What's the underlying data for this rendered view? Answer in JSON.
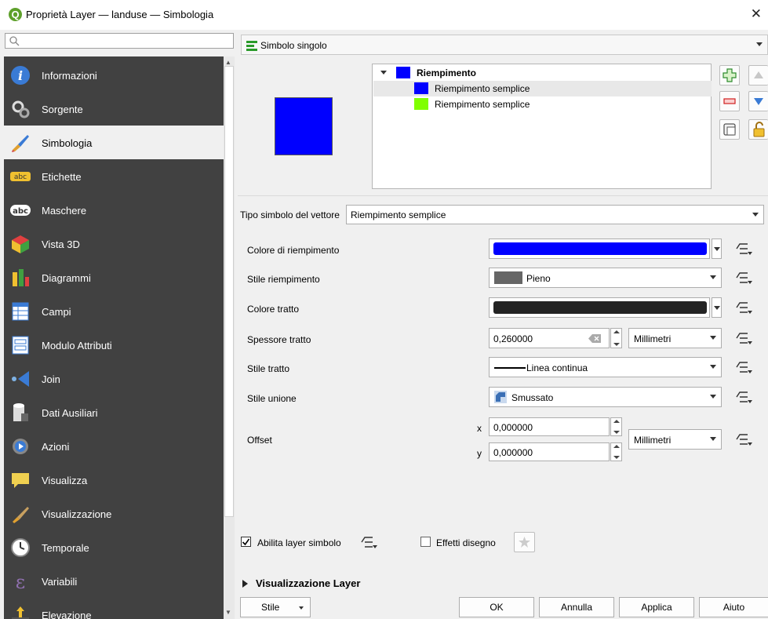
{
  "window": {
    "title": "Proprietà Layer — landuse — Simbologia",
    "app_icon": "Q"
  },
  "search": {
    "placeholder": ""
  },
  "sidebar": {
    "items": [
      {
        "label": "Informazioni",
        "icon": "info-icon"
      },
      {
        "label": "Sorgente",
        "icon": "source-icon"
      },
      {
        "label": "Simbologia",
        "icon": "symbology-icon",
        "active": true
      },
      {
        "label": "Etichette",
        "icon": "labels-icon"
      },
      {
        "label": "Maschere",
        "icon": "masks-icon"
      },
      {
        "label": "Vista 3D",
        "icon": "3d-view-icon"
      },
      {
        "label": "Diagrammi",
        "icon": "diagrams-icon"
      },
      {
        "label": "Campi",
        "icon": "fields-icon"
      },
      {
        "label": "Modulo Attributi",
        "icon": "attributes-form-icon"
      },
      {
        "label": "Join",
        "icon": "join-icon"
      },
      {
        "label": "Dati Ausiliari",
        "icon": "auxiliary-data-icon"
      },
      {
        "label": "Azioni",
        "icon": "actions-icon"
      },
      {
        "label": "Visualizza",
        "icon": "display-icon"
      },
      {
        "label": "Visualizzazione",
        "icon": "rendering-icon"
      },
      {
        "label": "Temporale",
        "icon": "temporal-icon"
      },
      {
        "label": "Variabili",
        "icon": "variables-icon"
      },
      {
        "label": "Elevazione",
        "icon": "elevation-icon"
      }
    ]
  },
  "renderer": {
    "label": "Simbolo singolo"
  },
  "symbol_tree": {
    "root": {
      "label": "Riempimento",
      "color": "#0000ff"
    },
    "layers": [
      {
        "label": "Riempimento semplice",
        "color": "#0000ff",
        "selected": true
      },
      {
        "label": "Riempimento semplice",
        "color": "#80ff00",
        "selected": false
      }
    ]
  },
  "symbol_layer_type": {
    "label": "Tipo simbolo del vettore",
    "value": "Riempimento semplice"
  },
  "properties": {
    "fill_color": {
      "label": "Colore di riempimento",
      "color": "#0000ff"
    },
    "fill_style": {
      "label": "Stile riempimento",
      "value": "Pieno"
    },
    "stroke_color": {
      "label": "Colore tratto",
      "color": "#232323"
    },
    "stroke_width": {
      "label": "Spessore tratto",
      "value": "0,260000",
      "unit": "Millimetri"
    },
    "stroke_style": {
      "label": "Stile tratto",
      "value": "Linea continua"
    },
    "join_style": {
      "label": "Stile unione",
      "value": "Smussato"
    },
    "offset": {
      "label": "Offset",
      "x_label": "x",
      "y_label": "y",
      "x": "0,000000",
      "y": "0,000000",
      "unit": "Millimetri"
    }
  },
  "options": {
    "enable_layer": {
      "label": "Abilita layer simbolo",
      "checked": true
    },
    "draw_effects": {
      "label": "Effetti disegno",
      "checked": false
    }
  },
  "layer_rendering": {
    "label": "Visualizzazione Layer"
  },
  "footer": {
    "style": "Stile",
    "ok": "OK",
    "cancel": "Annulla",
    "apply": "Applica",
    "help": "Aiuto"
  }
}
